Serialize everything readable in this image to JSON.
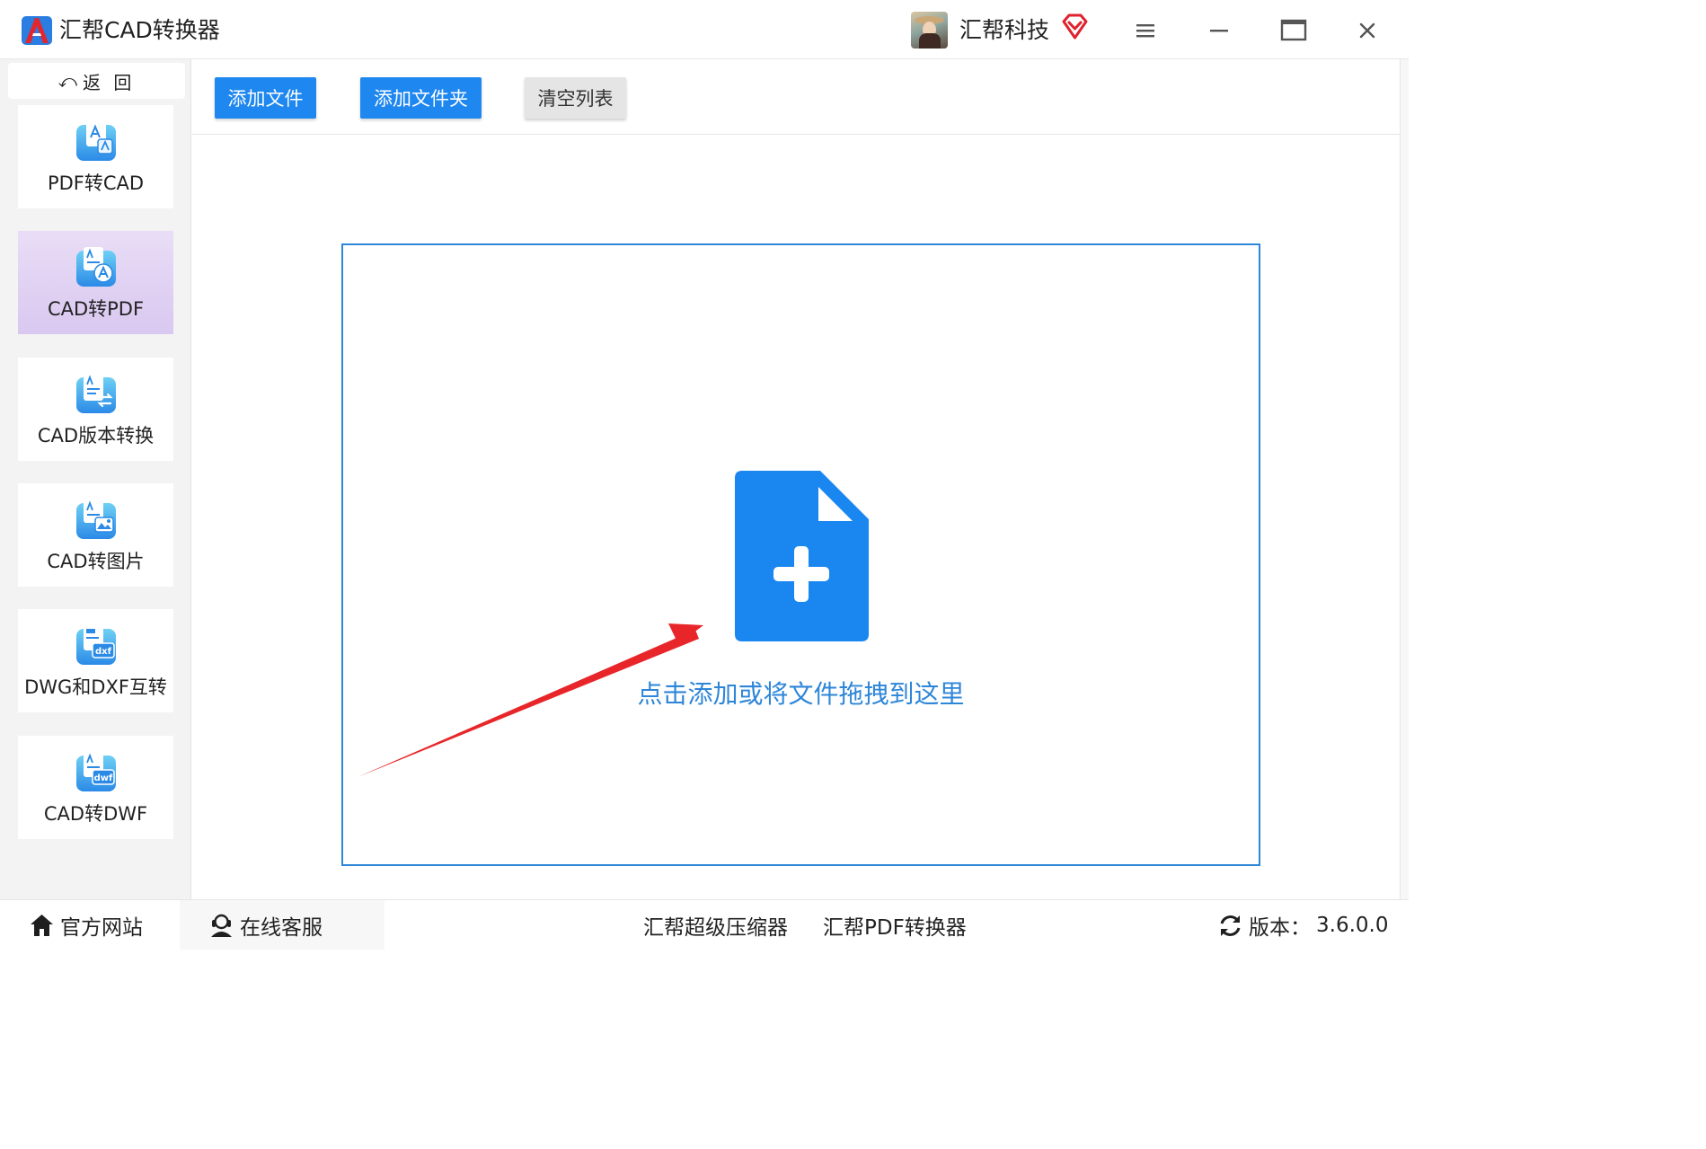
{
  "window": {
    "app_title": "汇帮CAD转换器",
    "user_name": "汇帮科技",
    "icons": [
      "app-logo-icon",
      "avatar",
      "vip-diamond-icon",
      "menu-icon",
      "minimize-icon",
      "maximize-icon",
      "close-icon"
    ]
  },
  "sidebar": {
    "back_label": "返 回",
    "back_icon": "undo-icon",
    "items": [
      {
        "label": "PDF转CAD",
        "icon": "pdf-to-cad-icon",
        "active": false
      },
      {
        "label": "CAD转PDF",
        "icon": "cad-to-pdf-icon",
        "active": true
      },
      {
        "label": "CAD版本转换",
        "icon": "cad-version-icon",
        "active": false
      },
      {
        "label": "CAD转图片",
        "icon": "cad-to-image-icon",
        "active": false
      },
      {
        "label": "DWG和DXF互转",
        "icon": "dwg-dxf-icon",
        "active": false
      },
      {
        "label": "CAD转DWF",
        "icon": "cad-to-dwf-icon",
        "active": false
      }
    ]
  },
  "toolbar": {
    "add_file_label": "添加文件",
    "add_folder_label": "添加文件夹",
    "clear_list_label": "清空列表"
  },
  "drop_zone": {
    "hint": "点击添加或将文件拖拽到这里",
    "icon": "add-file-icon",
    "annotation": "red-arrow"
  },
  "footer": {
    "official_site": "官方网站",
    "online_service": "在线客服",
    "compressor": "汇帮超级压缩器",
    "pdf_converter": "汇帮PDF转换器",
    "version_label": "版本：",
    "version_value": "3.6.0.0"
  },
  "colors": {
    "accent": "#1e87f0",
    "drop_border": "#2e86d8",
    "active_nav": "#dccbf1",
    "arrow": "#e8262a",
    "vip": "#e0222f"
  }
}
